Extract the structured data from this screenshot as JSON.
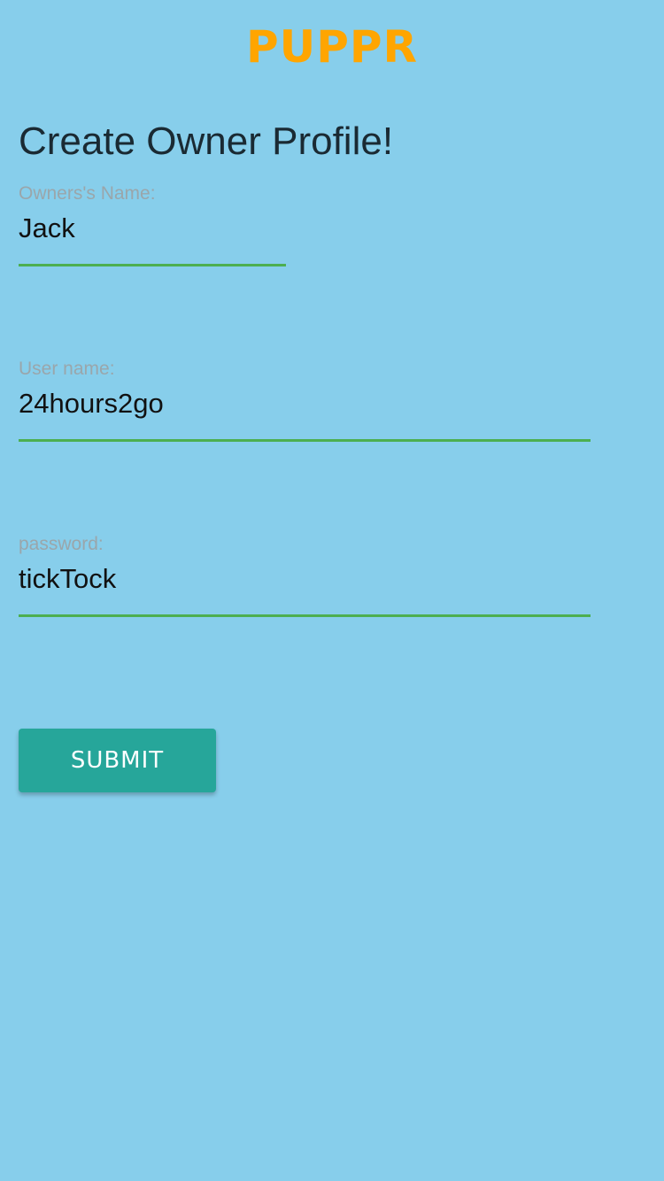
{
  "header": {
    "brand": "PUPPR"
  },
  "form": {
    "title": "Create Owner Profile!",
    "fields": [
      {
        "label": "Owners's Name:",
        "value": "Jack"
      },
      {
        "label": "User name:",
        "value": "24hours2go"
      },
      {
        "label": "password:",
        "value": "tickTock"
      }
    ],
    "submit_label": "SUBMIT"
  },
  "colors": {
    "background": "#87CEEB",
    "brand": "#FFA500",
    "underline": "#4CAF50",
    "button": "#26A69A"
  }
}
